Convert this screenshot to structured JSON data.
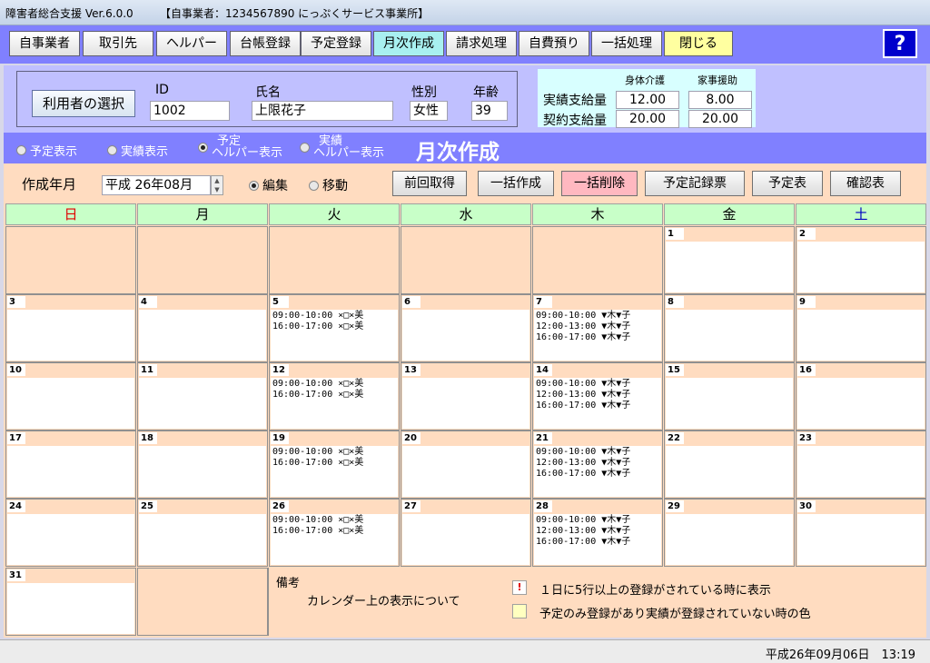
{
  "window": {
    "title": "障害者総合支援 Ver.6.0.0",
    "subtitle": "【自事業者：1234567890 にっぷくサービス事業所】",
    "minimize": "─",
    "maximize": "□",
    "close": "✕"
  },
  "toolbar": {
    "buttons": [
      "自事業者",
      "取引先",
      "ヘルパー",
      "台帳登録",
      "予定登録",
      "月次作成",
      "請求処理",
      "自費預り",
      "一括処理",
      "閉じる"
    ],
    "help": "?"
  },
  "user": {
    "select_button": "利用者の選択",
    "id_label": "ID",
    "id": "1002",
    "name_label": "氏名",
    "name": "上限花子",
    "gender_label": "性別",
    "gender": "女性",
    "age_label": "年齢",
    "age": "39"
  },
  "supply": {
    "col1": "身体介護",
    "col2": "家事援助",
    "row1_label": "実績支給量",
    "row2_label": "契約支給量",
    "row1_col1": "12.00",
    "row1_col2": "8.00",
    "row2_col1": "20.00",
    "row2_col2": "20.00"
  },
  "modes": {
    "options": [
      {
        "label": "予定表示",
        "selected": false
      },
      {
        "label": "実績表示",
        "selected": false
      },
      {
        "label_1": "予定",
        "label_2": "ヘルパー表示",
        "selected": true
      },
      {
        "label_1": "実績",
        "label_2": "ヘルパー表示",
        "selected": false
      }
    ],
    "title": "月次作成"
  },
  "controls": {
    "month_label": "作成年月",
    "month_value": "平成 26年08月",
    "edit": "編集",
    "move": "移動",
    "edit_selected": true,
    "buttons": [
      "前回取得",
      "一括作成",
      "一括削除",
      "予定記録票",
      "予定表",
      "確認表"
    ]
  },
  "weekdays": [
    {
      "label": "日",
      "color": "#e00000"
    },
    {
      "label": "月",
      "color": "#000000"
    },
    {
      "label": "火",
      "color": "#000000"
    },
    {
      "label": "水",
      "color": "#000000"
    },
    {
      "label": "木",
      "color": "#000000"
    },
    {
      "label": "金",
      "color": "#000000"
    },
    {
      "label": "土",
      "color": "#0000c0"
    }
  ],
  "days": [
    {
      "n": "1",
      "entries": []
    },
    {
      "n": "2",
      "entries": []
    },
    {
      "n": "3",
      "entries": []
    },
    {
      "n": "4",
      "entries": []
    },
    {
      "n": "5",
      "entries": [
        "09:00-10:00 ×□×美",
        "16:00-17:00 ×□×美"
      ]
    },
    {
      "n": "6",
      "entries": []
    },
    {
      "n": "7",
      "entries": [
        "09:00-10:00 ▼木▼子",
        "12:00-13:00 ▼木▼子",
        "16:00-17:00 ▼木▼子"
      ]
    },
    {
      "n": "8",
      "entries": []
    },
    {
      "n": "9",
      "entries": []
    },
    {
      "n": "10",
      "entries": []
    },
    {
      "n": "11",
      "entries": []
    },
    {
      "n": "12",
      "entries": [
        "09:00-10:00 ×□×美",
        "16:00-17:00 ×□×美"
      ]
    },
    {
      "n": "13",
      "entries": []
    },
    {
      "n": "14",
      "entries": [
        "09:00-10:00 ▼木▼子",
        "12:00-13:00 ▼木▼子",
        "16:00-17:00 ▼木▼子"
      ]
    },
    {
      "n": "15",
      "entries": []
    },
    {
      "n": "16",
      "entries": []
    },
    {
      "n": "17",
      "entries": []
    },
    {
      "n": "18",
      "entries": []
    },
    {
      "n": "19",
      "entries": [
        "09:00-10:00 ×□×美",
        "16:00-17:00 ×□×美"
      ]
    },
    {
      "n": "20",
      "entries": []
    },
    {
      "n": "21",
      "entries": [
        "09:00-10:00 ▼木▼子",
        "12:00-13:00 ▼木▼子",
        "16:00-17:00 ▼木▼子"
      ]
    },
    {
      "n": "22",
      "entries": []
    },
    {
      "n": "23",
      "entries": []
    },
    {
      "n": "24",
      "entries": []
    },
    {
      "n": "25",
      "entries": []
    },
    {
      "n": "26",
      "entries": [
        "09:00-10:00 ×□×美",
        "16:00-17:00 ×□×美"
      ]
    },
    {
      "n": "27",
      "entries": []
    },
    {
      "n": "28",
      "entries": [
        "09:00-10:00 ▼木▼子",
        "12:00-13:00 ▼木▼子",
        "16:00-17:00 ▼木▼子"
      ]
    },
    {
      "n": "29",
      "entries": []
    },
    {
      "n": "30",
      "entries": []
    },
    {
      "n": "31",
      "entries": []
    }
  ],
  "notes": {
    "title": "備考",
    "subtitle": "カレンダー上の表示について",
    "legend1_mark": "!",
    "legend1": "１日に5行以上の登録がされている時に表示",
    "legend2": "予定のみ登録があり実績が登録されていない時の色",
    "legend2_color": "#ffffc0"
  },
  "status": {
    "datetime": "平成26年09月06日　13:19"
  }
}
